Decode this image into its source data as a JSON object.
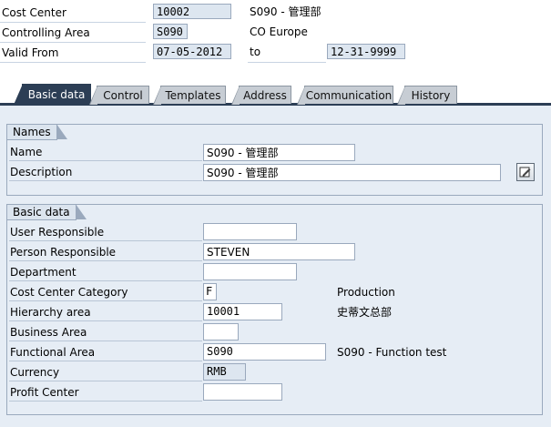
{
  "header": {
    "cost_center": {
      "label": "Cost Center",
      "value": "10002",
      "description": "S090 - 管理部"
    },
    "controlling_area": {
      "label": "Controlling Area",
      "value": "S090",
      "description": "CO Europe"
    },
    "valid_from": {
      "label": "Valid From",
      "value": "07-05-2012",
      "to_label": "to",
      "to_value": "12-31-9999"
    }
  },
  "tabs": [
    {
      "label": "Basic data",
      "active": true
    },
    {
      "label": "Control",
      "active": false
    },
    {
      "label": "Templates",
      "active": false
    },
    {
      "label": "Address",
      "active": false
    },
    {
      "label": "Communication",
      "active": false
    },
    {
      "label": "History",
      "active": false
    }
  ],
  "names_group": {
    "title": "Names",
    "name_label": "Name",
    "name_value": "S090 - 管理部",
    "description_label": "Description",
    "description_value": "S090 - 管理部",
    "edit_icon": "pencil-edit-icon"
  },
  "basic_group": {
    "title": "Basic data",
    "user_responsible": {
      "label": "User Responsible",
      "value": ""
    },
    "person_responsible": {
      "label": "Person Responsible",
      "value": "STEVEN"
    },
    "department": {
      "label": "Department",
      "value": ""
    },
    "category": {
      "label": "Cost Center Category",
      "value": "F",
      "text": "Production"
    },
    "hierarchy": {
      "label": "Hierarchy area",
      "value": "10001",
      "text": "史蒂文总部"
    },
    "business_area": {
      "label": "Business Area",
      "value": ""
    },
    "functional_area": {
      "label": "Functional Area",
      "value": "S090",
      "text": "S090 - Function test"
    },
    "currency": {
      "label": "Currency",
      "value": "RMB"
    },
    "profit_center": {
      "label": "Profit Center",
      "value": ""
    }
  },
  "colors": {
    "tab_active": "#2c3e55",
    "tab_inactive": "#c7cdd4",
    "panel_bg": "#e6edf5",
    "field_ro_bg": "#dde6f0"
  }
}
